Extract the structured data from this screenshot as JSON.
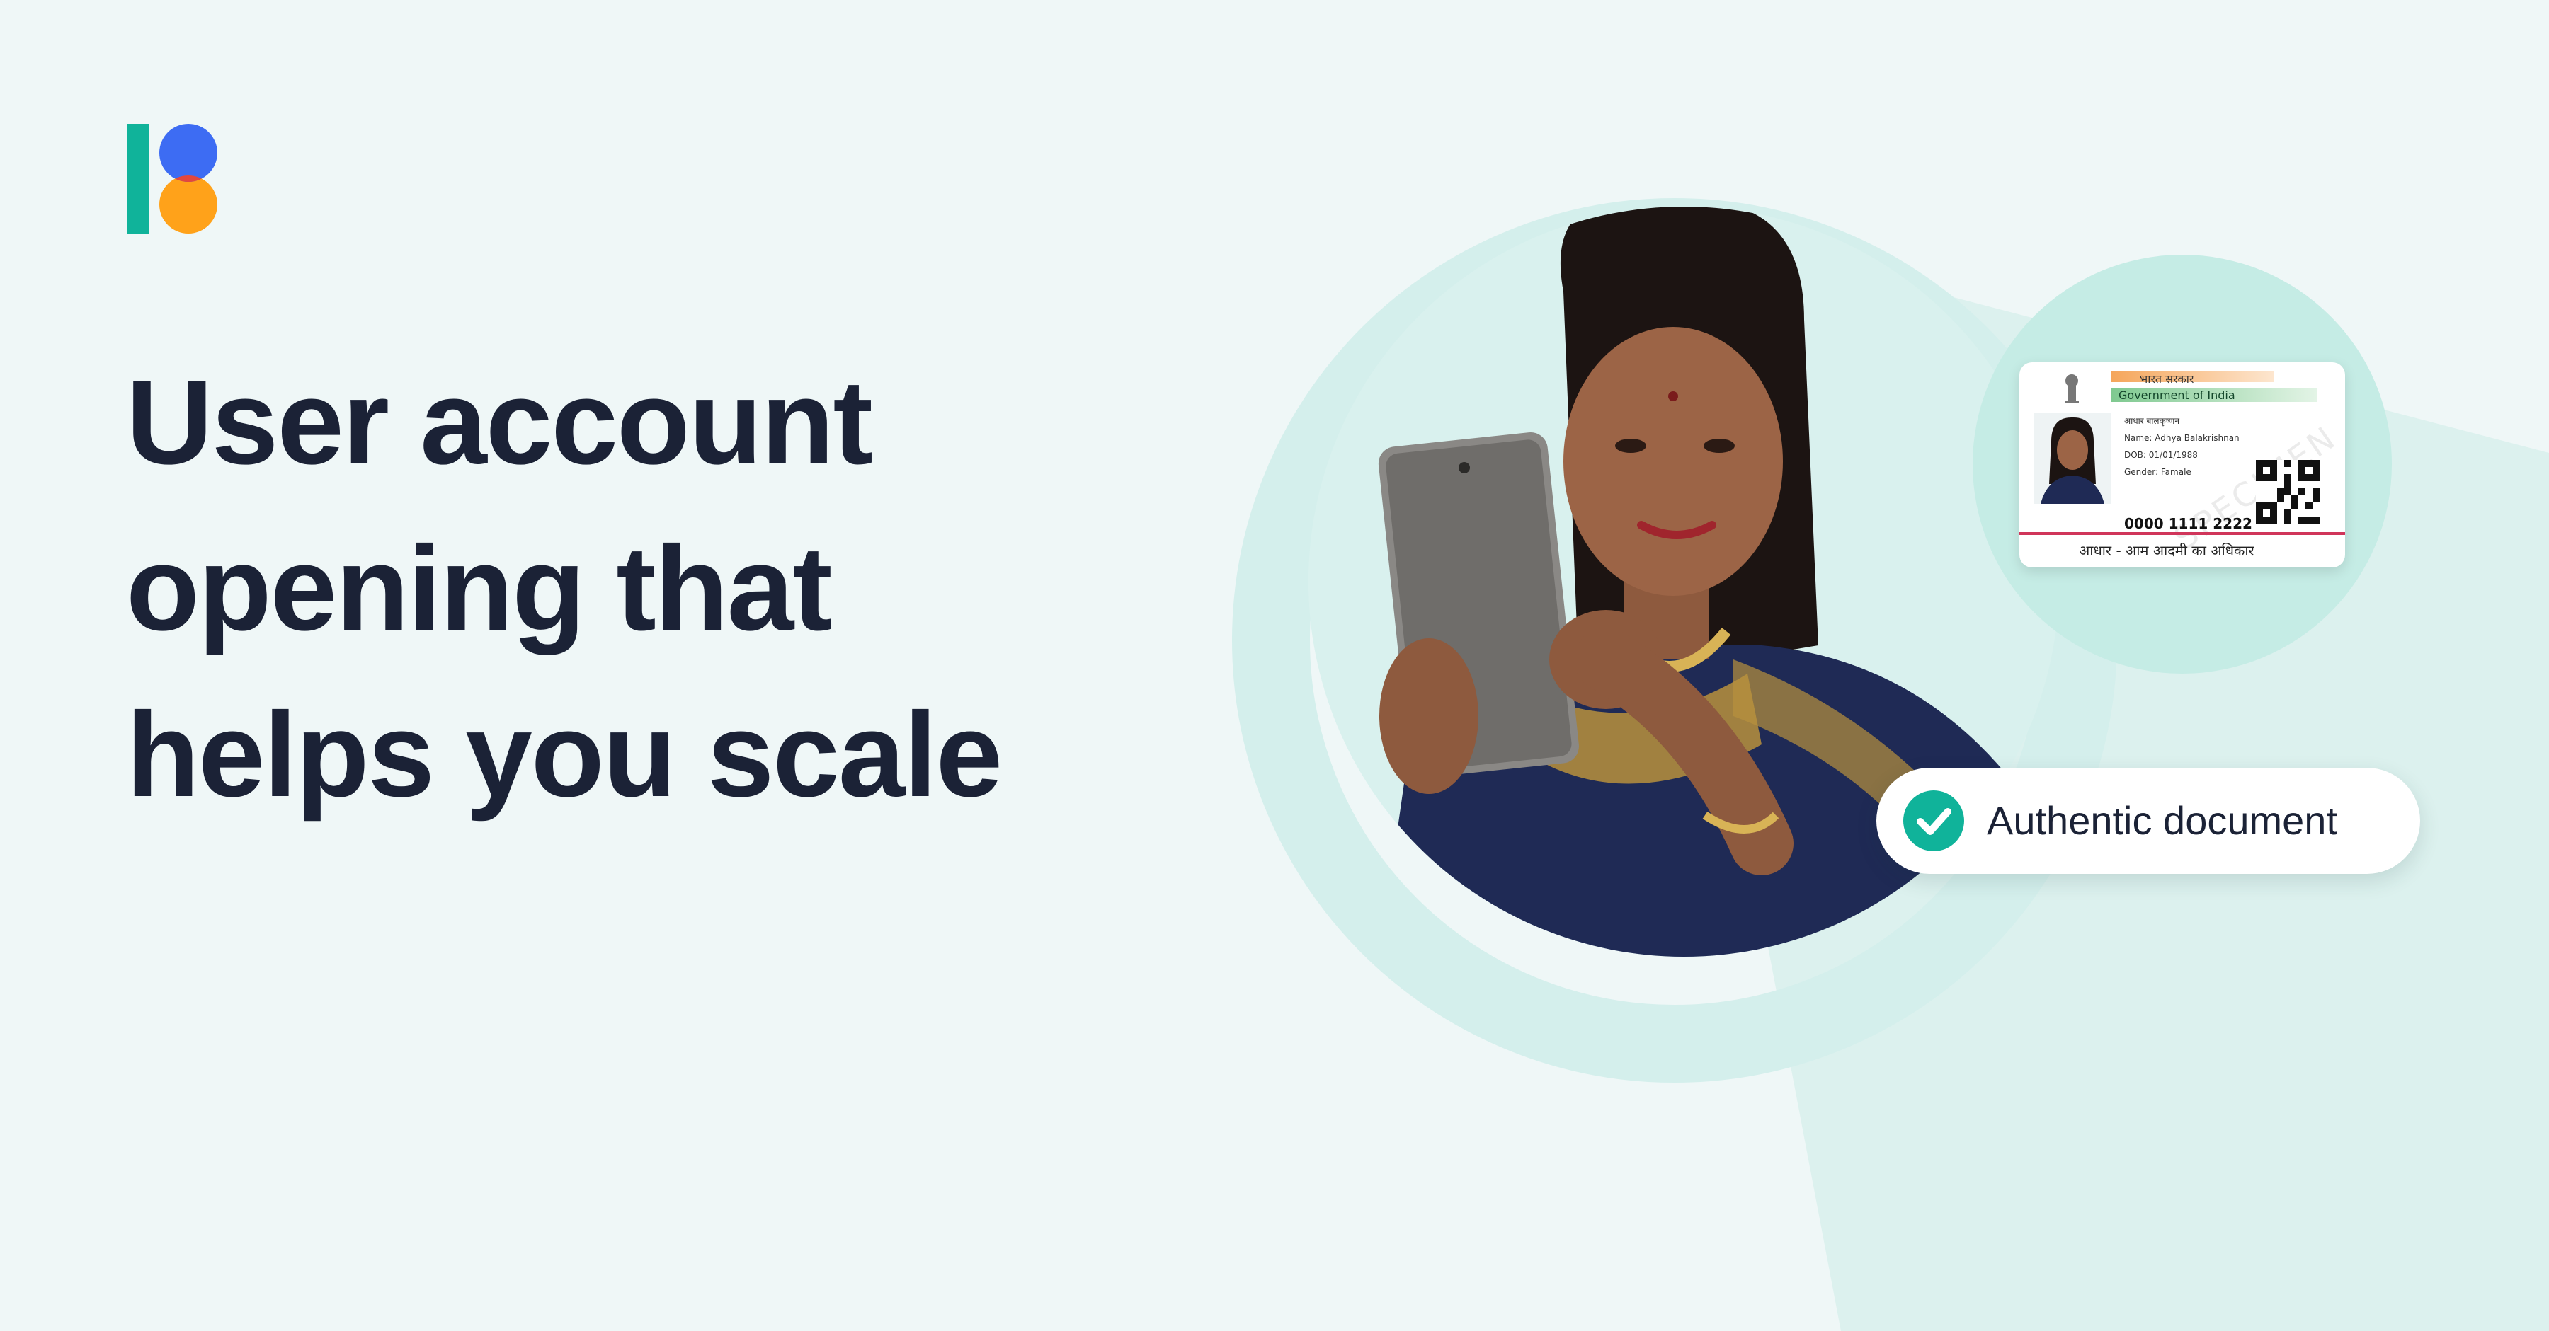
{
  "brand": {
    "logo_icon": "brand-logo",
    "colors": {
      "bar": "#10b39a",
      "blue": "#3d6cf3",
      "orange": "#ffa21a"
    }
  },
  "headline": {
    "lines": [
      "User account",
      "opening that",
      "helps you scale"
    ]
  },
  "id_card": {
    "header_hindi": "भारत सरकार",
    "header_en": "Government of India",
    "name_hindi": "आधार बालकृष्णन",
    "name": "Name: Adhya Balakrishnan",
    "dob": "DOB: 01/01/1988",
    "gender": "Gender: Famale",
    "number": "0000 1111 2222",
    "tagline": "आधार - आम आदमी का अधिकार",
    "watermark": "SPECIMEN"
  },
  "status_pill": {
    "icon": "check-circle-icon",
    "label": "Authentic document"
  },
  "colors": {
    "background": "#eff7f7",
    "accent_teal": "#10b39a",
    "ring": "#d4efec",
    "text_dark": "#1b2236"
  }
}
